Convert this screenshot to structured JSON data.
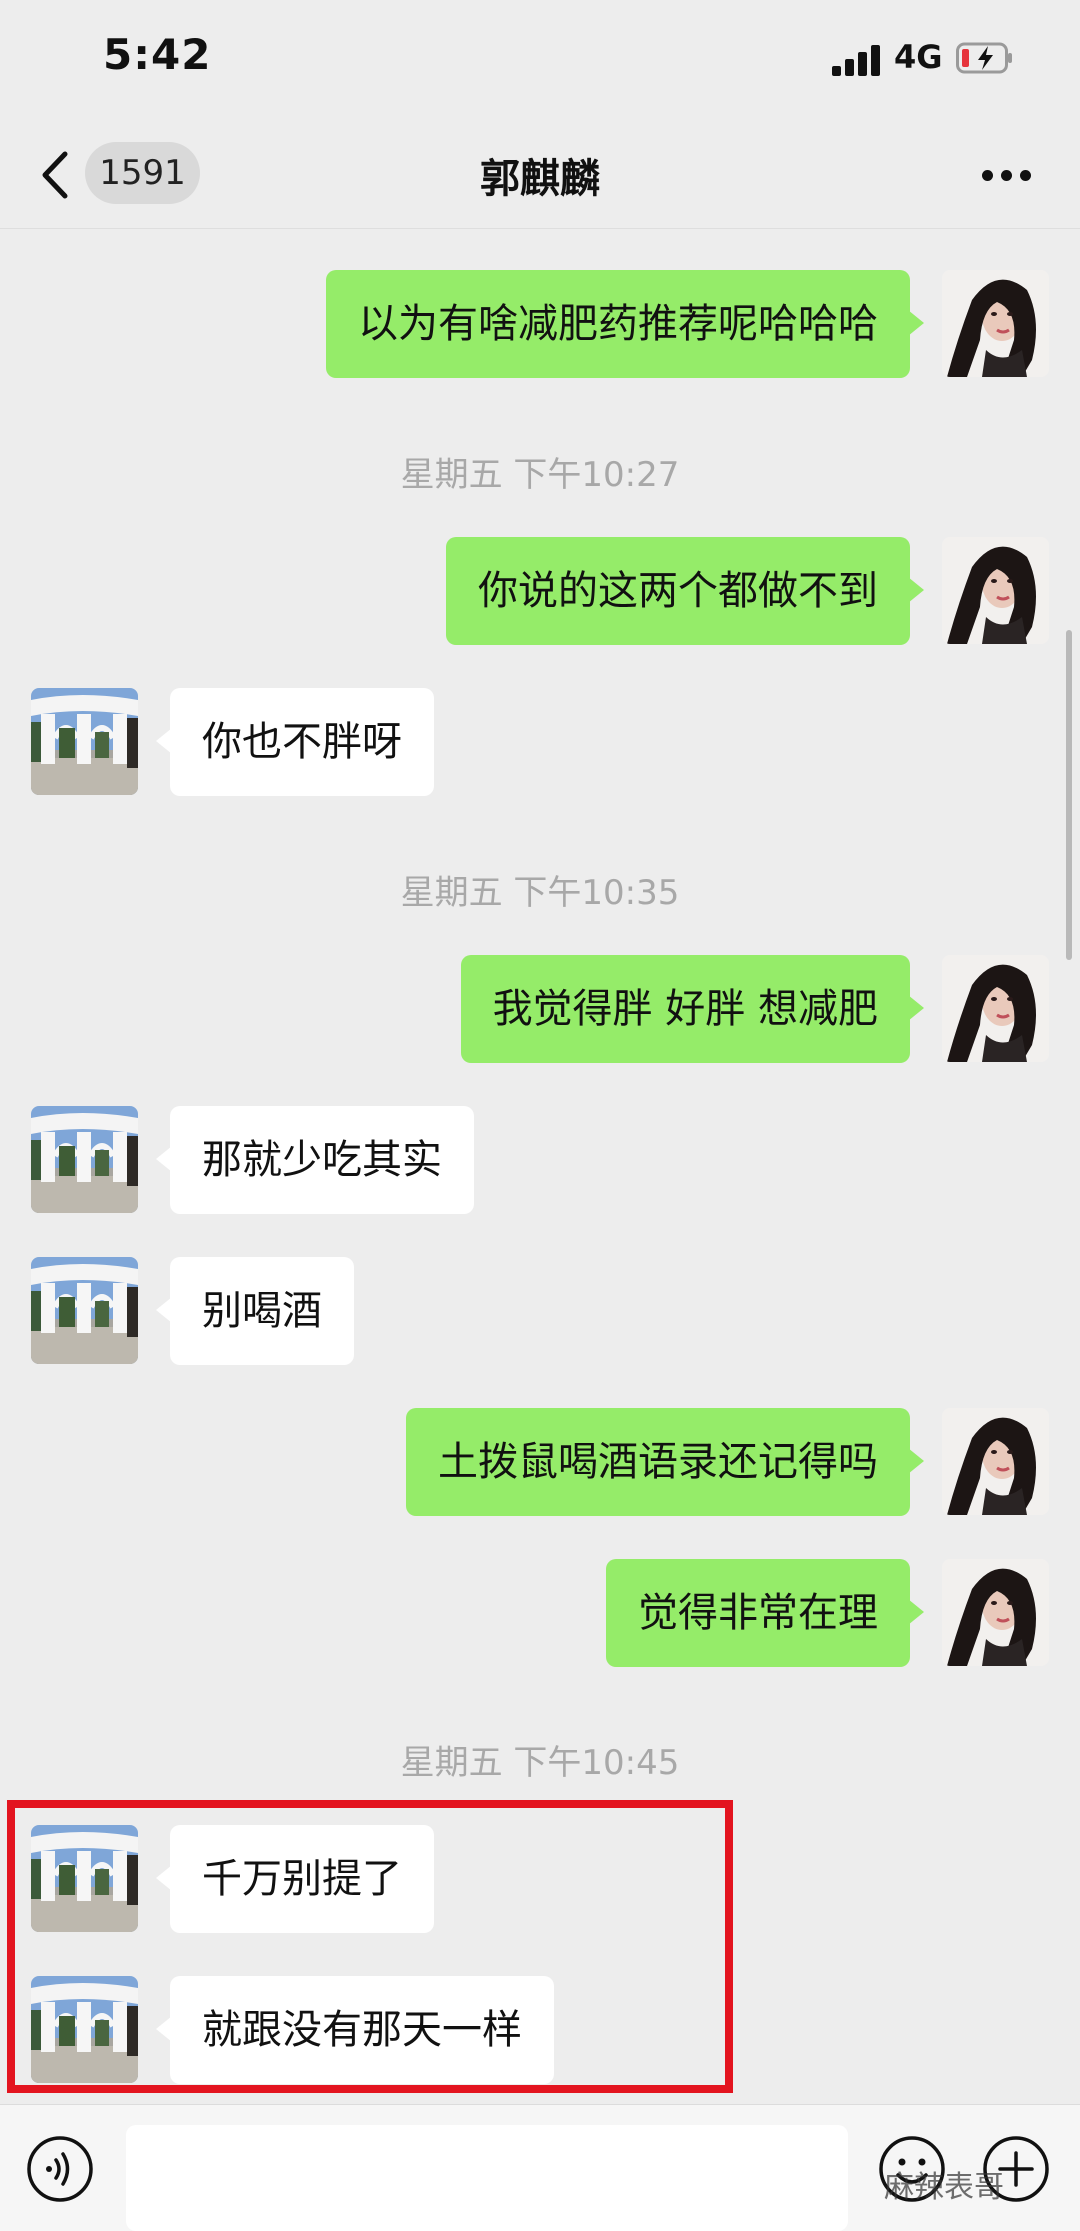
{
  "status": {
    "time": "5:42",
    "network": "4G"
  },
  "nav": {
    "unread_count": "1591",
    "title": "郭麒麟"
  },
  "messages": [
    {
      "side": "me",
      "text": "以为有啥减肥药推荐呢哈哈哈"
    },
    {
      "side": "me",
      "text": "你说的这两个都做不到"
    },
    {
      "side": "them",
      "text": "你也不胖呀"
    },
    {
      "side": "me",
      "text": "我觉得胖 好胖 想减肥"
    },
    {
      "side": "them",
      "text": "那就少吃其实"
    },
    {
      "side": "them",
      "text": "别喝酒"
    },
    {
      "side": "me",
      "text": "土拨鼠喝酒语录还记得吗"
    },
    {
      "side": "me",
      "text": "觉得非常在理"
    },
    {
      "side": "them",
      "text": "千万别提了"
    },
    {
      "side": "them",
      "text": "就跟没有那天一样"
    }
  ],
  "timestamps": [
    "星期五 下午10:27",
    "星期五 下午10:35",
    "星期五 下午10:45"
  ],
  "watermark": "麻辣表哥",
  "colors": {
    "my_bubble": "#95ec69",
    "their_bubble": "#ffffff",
    "highlight": "#e3141f",
    "background": "#ededed"
  }
}
